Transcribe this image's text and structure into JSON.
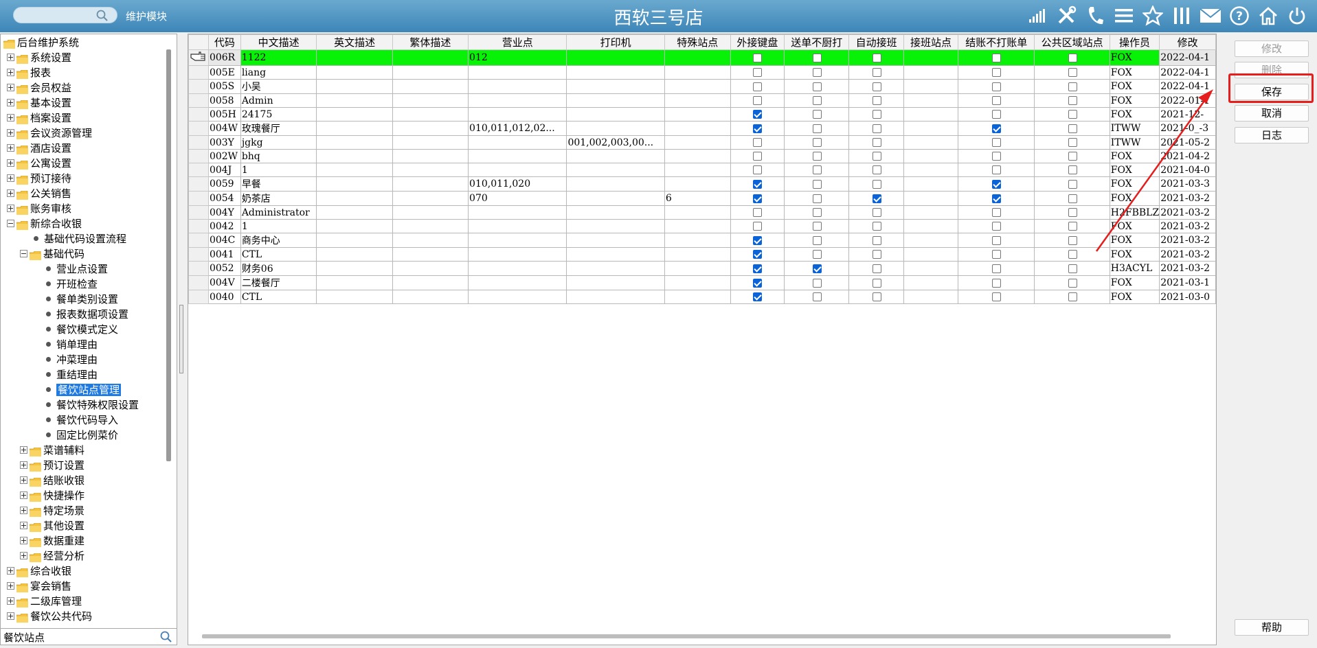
{
  "header": {
    "search_placeholder": "",
    "module_label": "维护模块",
    "store_title": "西软三号店",
    "icons": [
      "signal-icon",
      "tools-icon",
      "phone-icon",
      "menu-icon",
      "star-icon",
      "columns-icon",
      "mail-icon",
      "help-icon",
      "home-icon",
      "power-icon"
    ]
  },
  "sidebar": {
    "root": "后台维护系统",
    "items": [
      {
        "label": "系统设置",
        "level": 1,
        "type": "folder",
        "expanded": false
      },
      {
        "label": "报表",
        "level": 1,
        "type": "folder",
        "expanded": false
      },
      {
        "label": "会员权益",
        "level": 1,
        "type": "folder",
        "expanded": false
      },
      {
        "label": "基本设置",
        "level": 1,
        "type": "folder",
        "expanded": false
      },
      {
        "label": "档案设置",
        "level": 1,
        "type": "folder",
        "expanded": false
      },
      {
        "label": "会议资源管理",
        "level": 1,
        "type": "folder",
        "expanded": false
      },
      {
        "label": "酒店设置",
        "level": 1,
        "type": "folder",
        "expanded": false
      },
      {
        "label": "公寓设置",
        "level": 1,
        "type": "folder",
        "expanded": false
      },
      {
        "label": "预订接待",
        "level": 1,
        "type": "folder",
        "expanded": false
      },
      {
        "label": "公关销售",
        "level": 1,
        "type": "folder",
        "expanded": false
      },
      {
        "label": "账务审核",
        "level": 1,
        "type": "folder",
        "expanded": false
      },
      {
        "label": "新综合收银",
        "level": 1,
        "type": "folder",
        "expanded": true
      },
      {
        "label": "基础代码设置流程",
        "level": 2,
        "type": "leaf"
      },
      {
        "label": "基础代码",
        "level": 2,
        "type": "folder",
        "expanded": true
      },
      {
        "label": "营业点设置",
        "level": 3,
        "type": "leaf"
      },
      {
        "label": "开班检查",
        "level": 3,
        "type": "leaf"
      },
      {
        "label": "餐单类别设置",
        "level": 3,
        "type": "leaf"
      },
      {
        "label": "报表数据项设置",
        "level": 3,
        "type": "leaf"
      },
      {
        "label": "餐饮模式定义",
        "level": 3,
        "type": "leaf"
      },
      {
        "label": "销单理由",
        "level": 3,
        "type": "leaf"
      },
      {
        "label": "冲菜理由",
        "level": 3,
        "type": "leaf"
      },
      {
        "label": "重结理由",
        "level": 3,
        "type": "leaf"
      },
      {
        "label": "餐饮站点管理",
        "level": 3,
        "type": "leaf",
        "selected": true
      },
      {
        "label": "餐饮特殊权限设置",
        "level": 3,
        "type": "leaf"
      },
      {
        "label": "餐饮代码导入",
        "level": 3,
        "type": "leaf"
      },
      {
        "label": "固定比例菜价",
        "level": 3,
        "type": "leaf"
      },
      {
        "label": "菜谱辅料",
        "level": 2,
        "type": "folder",
        "expanded": false
      },
      {
        "label": "预订设置",
        "level": 2,
        "type": "folder",
        "expanded": false
      },
      {
        "label": "结账收银",
        "level": 2,
        "type": "folder",
        "expanded": false
      },
      {
        "label": "快捷操作",
        "level": 2,
        "type": "folder",
        "expanded": false
      },
      {
        "label": "特定场景",
        "level": 2,
        "type": "folder",
        "expanded": false
      },
      {
        "label": "其他设置",
        "level": 2,
        "type": "folder",
        "expanded": false
      },
      {
        "label": "数据重建",
        "level": 2,
        "type": "folder",
        "expanded": false
      },
      {
        "label": "经营分析",
        "level": 2,
        "type": "folder",
        "expanded": false
      },
      {
        "label": "综合收银",
        "level": 1,
        "type": "folder",
        "expanded": false
      },
      {
        "label": "宴会销售",
        "level": 1,
        "type": "folder",
        "expanded": false
      },
      {
        "label": "二级库管理",
        "level": 1,
        "type": "folder",
        "expanded": false
      },
      {
        "label": "餐饮公共代码",
        "level": 1,
        "type": "folder",
        "expanded": false
      }
    ],
    "search_value": "餐饮站点"
  },
  "grid": {
    "columns": [
      "代码",
      "中文描述",
      "英文描述",
      "繁体描述",
      "营业点",
      "打印机",
      "特殊站点",
      "外接键盘",
      "送单不厨打",
      "自动接班",
      "接班站点",
      "结账不打账单",
      "公共区域站点",
      "操作员",
      "修改"
    ],
    "rows": [
      {
        "code": "006R",
        "cn": "1122",
        "en": "",
        "tw": "",
        "outlet": "012",
        "printer": "",
        "special": "",
        "kb": false,
        "nokit": false,
        "auto": false,
        "shift_station": "",
        "nobill": false,
        "public": false,
        "operator": "FOX",
        "modified": "2022-04-1",
        "selected": true
      },
      {
        "code": "005E",
        "cn": "liang",
        "en": "",
        "tw": "",
        "outlet": "",
        "printer": "",
        "special": "",
        "kb": false,
        "nokit": false,
        "auto": false,
        "shift_station": "",
        "nobill": false,
        "public": false,
        "operator": "FOX",
        "modified": "2022-04-1"
      },
      {
        "code": "005S",
        "cn": "小吴",
        "en": "",
        "tw": "",
        "outlet": "",
        "printer": "",
        "special": "",
        "kb": false,
        "nokit": false,
        "auto": false,
        "shift_station": "",
        "nobill": false,
        "public": false,
        "operator": "FOX",
        "modified": "2022-04-1"
      },
      {
        "code": "0058",
        "cn": "Admin",
        "en": "",
        "tw": "",
        "outlet": "",
        "printer": "",
        "special": "",
        "kb": false,
        "nokit": false,
        "auto": false,
        "shift_station": "",
        "nobill": false,
        "public": false,
        "operator": "FOX",
        "modified": "2022-01-1"
      },
      {
        "code": "005H",
        "cn": "24175",
        "en": "",
        "tw": "",
        "outlet": "",
        "printer": "",
        "special": "",
        "kb": true,
        "nokit": false,
        "auto": false,
        "shift_station": "",
        "nobill": false,
        "public": false,
        "operator": "FOX",
        "modified": "2021-12-"
      },
      {
        "code": "004W",
        "cn": "玫瑰餐厅",
        "en": "",
        "tw": "",
        "outlet": "010,011,012,02...",
        "printer": "",
        "special": "",
        "kb": true,
        "nokit": false,
        "auto": false,
        "shift_station": "",
        "nobill": true,
        "public": false,
        "operator": "ITWW",
        "modified": "2021-0_-3"
      },
      {
        "code": "003Y",
        "cn": "jgkg",
        "en": "",
        "tw": "",
        "outlet": "",
        "printer": "001,002,003,00...",
        "special": "",
        "kb": false,
        "nokit": false,
        "auto": false,
        "shift_station": "",
        "nobill": false,
        "public": false,
        "operator": "ITWW",
        "modified": "2021-05-2"
      },
      {
        "code": "002W",
        "cn": "bhq",
        "en": "",
        "tw": "",
        "outlet": "",
        "printer": "",
        "special": "",
        "kb": false,
        "nokit": false,
        "auto": false,
        "shift_station": "",
        "nobill": false,
        "public": false,
        "operator": "FOX",
        "modified": "2021-04-2"
      },
      {
        "code": "004J",
        "cn": "1",
        "en": "",
        "tw": "",
        "outlet": "",
        "printer": "",
        "special": "",
        "kb": false,
        "nokit": false,
        "auto": false,
        "shift_station": "",
        "nobill": false,
        "public": false,
        "operator": "FOX",
        "modified": "2021-04-0"
      },
      {
        "code": "0059",
        "cn": "早餐",
        "en": "",
        "tw": "",
        "outlet": "010,011,020",
        "printer": "",
        "special": "",
        "kb": true,
        "nokit": false,
        "auto": false,
        "shift_station": "",
        "nobill": true,
        "public": false,
        "operator": "FOX",
        "modified": "2021-03-3"
      },
      {
        "code": "0054",
        "cn": "奶茶店",
        "en": "",
        "tw": "",
        "outlet": "070",
        "printer": "",
        "special": "6",
        "kb": true,
        "nokit": false,
        "auto": true,
        "shift_station": "",
        "nobill": true,
        "public": false,
        "operator": "FOX",
        "modified": "2021-03-2"
      },
      {
        "code": "004Y",
        "cn": "Administrator",
        "en": "",
        "tw": "",
        "outlet": "",
        "printer": "",
        "special": "",
        "kb": false,
        "nokit": false,
        "auto": false,
        "shift_station": "",
        "nobill": false,
        "public": false,
        "operator": "H2FBBLZ",
        "modified": "2021-03-2"
      },
      {
        "code": "0042",
        "cn": "1",
        "en": "",
        "tw": "",
        "outlet": "",
        "printer": "",
        "special": "",
        "kb": false,
        "nokit": false,
        "auto": false,
        "shift_station": "",
        "nobill": false,
        "public": false,
        "operator": "FOX",
        "modified": "2021-03-2"
      },
      {
        "code": "004C",
        "cn": "商务中心",
        "en": "",
        "tw": "",
        "outlet": "",
        "printer": "",
        "special": "",
        "kb": true,
        "nokit": false,
        "auto": false,
        "shift_station": "",
        "nobill": false,
        "public": false,
        "operator": "FOX",
        "modified": "2021-03-2"
      },
      {
        "code": "0041",
        "cn": "CTL",
        "en": "",
        "tw": "",
        "outlet": "",
        "printer": "",
        "special": "",
        "kb": true,
        "nokit": false,
        "auto": false,
        "shift_station": "",
        "nobill": false,
        "public": false,
        "operator": "FOX",
        "modified": "2021-03-2"
      },
      {
        "code": "0052",
        "cn": "财务06",
        "en": "",
        "tw": "",
        "outlet": "",
        "printer": "",
        "special": "",
        "kb": true,
        "nokit": true,
        "auto": false,
        "shift_station": "",
        "nobill": false,
        "public": false,
        "operator": "H3ACYL",
        "modified": "2021-03-2"
      },
      {
        "code": "004V",
        "cn": "二楼餐厅",
        "en": "",
        "tw": "",
        "outlet": "",
        "printer": "",
        "special": "",
        "kb": true,
        "nokit": false,
        "auto": false,
        "shift_station": "",
        "nobill": false,
        "public": false,
        "operator": "FOX",
        "modified": "2021-03-1"
      },
      {
        "code": "0040",
        "cn": "CTL",
        "en": "",
        "tw": "",
        "outlet": "",
        "printer": "",
        "special": "",
        "kb": true,
        "nokit": false,
        "auto": false,
        "shift_station": "",
        "nobill": false,
        "public": false,
        "operator": "FOX",
        "modified": "2021-03-0"
      }
    ]
  },
  "actions": {
    "modify": "修改",
    "delete": "删除",
    "save": "保存",
    "cancel": "取消",
    "log": "日志",
    "help": "帮助"
  },
  "colors": {
    "header": "#3d86b8",
    "selected_row": "#08f208",
    "checkbox_on": "#0a64d8",
    "tree_selected": "#1f7be3",
    "annotation": "#e51d1d"
  }
}
